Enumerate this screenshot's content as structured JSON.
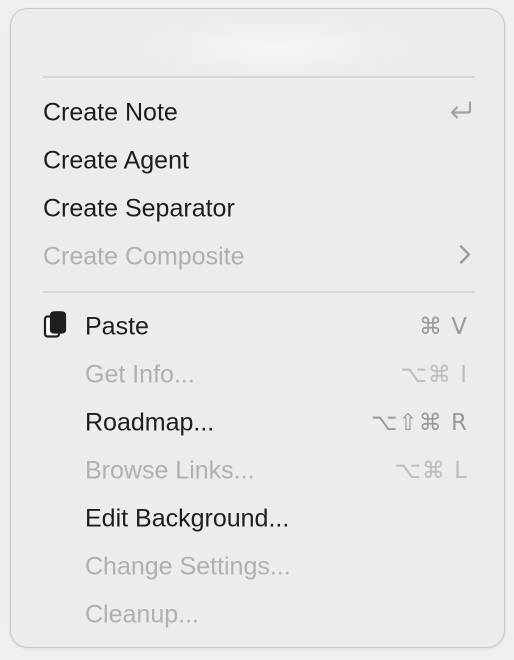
{
  "menu": {
    "section1": [
      {
        "label": "Create Note",
        "enabled": true,
        "accessory": "return-icon"
      },
      {
        "label": "Create Agent",
        "enabled": true
      },
      {
        "label": "Create Separator",
        "enabled": true
      },
      {
        "label": "Create Composite",
        "enabled": false,
        "accessory": "chevron-right-icon"
      }
    ],
    "section2": [
      {
        "label": "Paste",
        "enabled": true,
        "icon": "clipboard-icon",
        "shortcut": "⌘ V"
      },
      {
        "label": "Get Info...",
        "enabled": false,
        "shortcut": "⌥⌘ I"
      },
      {
        "label": "Roadmap...",
        "enabled": true,
        "shortcut": "⌥⇧⌘ R"
      },
      {
        "label": "Browse Links...",
        "enabled": false,
        "shortcut": "⌥⌘ L"
      },
      {
        "label": "Edit Background...",
        "enabled": true
      },
      {
        "label": "Change Settings...",
        "enabled": false
      },
      {
        "label": "Cleanup...",
        "enabled": false
      }
    ]
  },
  "colors": {
    "menu_background": "#ececec",
    "text_enabled": "#1e1e1e",
    "text_disabled": "#b0b0b0",
    "shortcut_text": "#9a9a9a",
    "separator": "#d6d6d6"
  }
}
